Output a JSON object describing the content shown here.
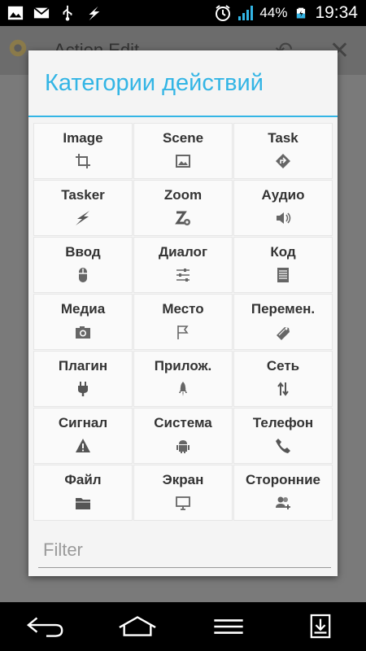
{
  "status_bar": {
    "battery_percent": "44%",
    "time": "19:34",
    "icons": [
      "image-icon",
      "mail-icon",
      "usb-icon",
      "tasker-bolt-icon",
      "alarm-icon",
      "signal-icon",
      "battery-icon"
    ]
  },
  "background_app": {
    "title": "Action Edit"
  },
  "dialog": {
    "title": "Категории действий",
    "categories": [
      {
        "label": "Image",
        "icon": "crop-icon"
      },
      {
        "label": "Scene",
        "icon": "picture-icon"
      },
      {
        "label": "Task",
        "icon": "diamond-arrow-icon"
      },
      {
        "label": "Tasker",
        "icon": "bolt-icon"
      },
      {
        "label": "Zoom",
        "icon": "zoom-gear-icon"
      },
      {
        "label": "Аудио",
        "icon": "speaker-icon"
      },
      {
        "label": "Ввод",
        "icon": "mouse-icon"
      },
      {
        "label": "Диалог",
        "icon": "sliders-icon"
      },
      {
        "label": "Код",
        "icon": "document-icon"
      },
      {
        "label": "Медиа",
        "icon": "camera-icon"
      },
      {
        "label": "Место",
        "icon": "flag-icon"
      },
      {
        "label": "Перемен.",
        "icon": "tag-icon"
      },
      {
        "label": "Плагин",
        "icon": "plug-icon"
      },
      {
        "label": "Прилож.",
        "icon": "rocket-icon"
      },
      {
        "label": "Сеть",
        "icon": "up-down-arrows-icon"
      },
      {
        "label": "Сигнал",
        "icon": "warning-icon"
      },
      {
        "label": "Система",
        "icon": "android-icon"
      },
      {
        "label": "Телефон",
        "icon": "phone-icon"
      },
      {
        "label": "Файл",
        "icon": "folder-icon"
      },
      {
        "label": "Экран",
        "icon": "monitor-icon"
      },
      {
        "label": "Сторонние",
        "icon": "people-add-icon"
      }
    ],
    "filter_placeholder": "Filter",
    "filter_value": ""
  },
  "navigation": {
    "buttons": [
      "back-button",
      "home-button",
      "menu-button",
      "notifications-button"
    ]
  }
}
